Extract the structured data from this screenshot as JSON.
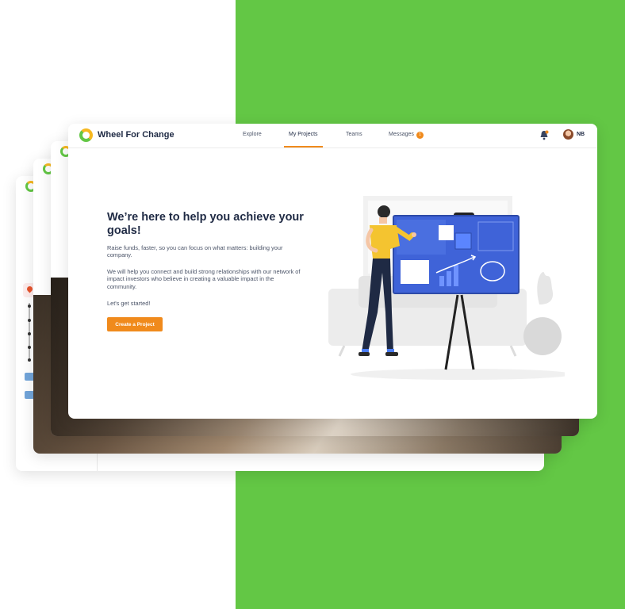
{
  "app": {
    "brand": "Wheel For Change",
    "nav": {
      "explore": "Explore",
      "my_projects": "My Projects",
      "teams": "Teams",
      "messages": "Messages",
      "messages_badge": "1",
      "active": "My Projects"
    },
    "user_initials": "NB"
  },
  "hero": {
    "title": "We’re here to help you achieve your goals!",
    "paragraph1": "Raise funds, faster, so you can focus on what matters: building your company.",
    "paragraph2": "We will help you connect and build strong relationships with our network of impact investors who believe in creating a valuable impact in the community.",
    "paragraph3": "Let's get started!",
    "cta_label": "Create a Project"
  },
  "colors": {
    "brand_green": "#63c745",
    "accent_orange": "#f08a1c",
    "text_dark": "#1f2a44",
    "board_blue": "#3f63d8"
  },
  "icons": [
    "bell-icon",
    "avatar",
    "logo-icon",
    "location-pin-icon"
  ]
}
